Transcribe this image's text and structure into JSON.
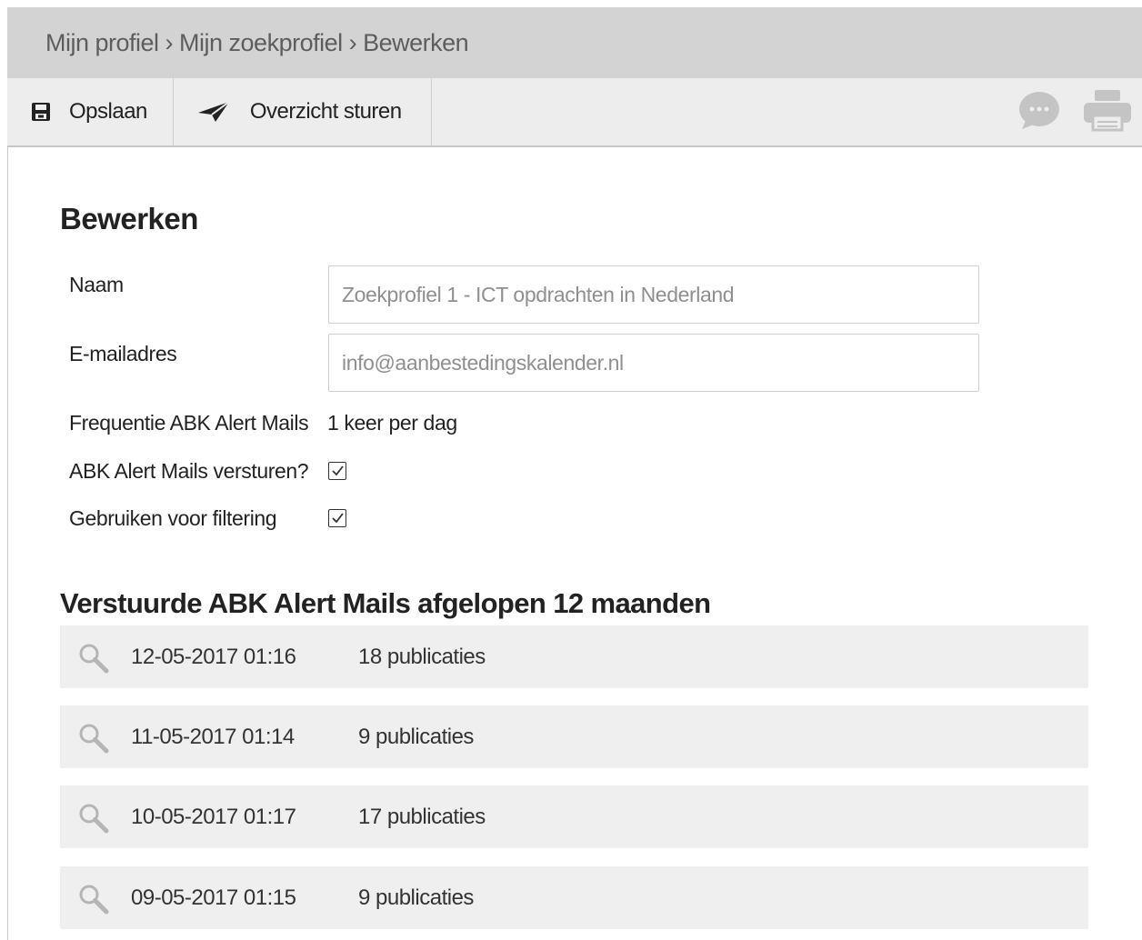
{
  "breadcrumb": {
    "text": "Mijn profiel › Mijn zoekprofiel › Bewerken"
  },
  "toolbar": {
    "save_label": "Opslaan",
    "send_label": "Overzicht sturen",
    "icons": [
      "save-icon",
      "send-icon",
      "chat-icon",
      "print-icon"
    ]
  },
  "form": {
    "title": "Bewerken",
    "name_label": "Naam",
    "name_placeholder": "Zoekprofiel 1 - ICT opdrachten in Nederland",
    "email_label": "E-mailadres",
    "email_value": "info@aanbestedingskalender.nl",
    "frequency_label": "Frequentie ABK Alert Mails",
    "frequency_value": "1 keer per dag",
    "send_label": "ABK Alert Mails versturen?",
    "send_checked": true,
    "filter_label": "Gebruiken voor filtering",
    "filter_checked": true
  },
  "mails": {
    "title": "Verstuurde ABK Alert Mails afgelopen 12 maanden",
    "items": [
      {
        "date": "12-05-2017 01:16",
        "count": "18 publicaties"
      },
      {
        "date": "11-05-2017 01:14",
        "count": "9 publicaties"
      },
      {
        "date": "10-05-2017 01:17",
        "count": "17 publicaties"
      },
      {
        "date": "09-05-2017 01:15",
        "count": "9 publicaties"
      }
    ]
  },
  "colors": {
    "breadcrumb_bg": "#d3d3d3",
    "toolbar_bg": "#ededed",
    "list_item_bg": "#efefef",
    "muted_icon": "#c4c4c4"
  }
}
